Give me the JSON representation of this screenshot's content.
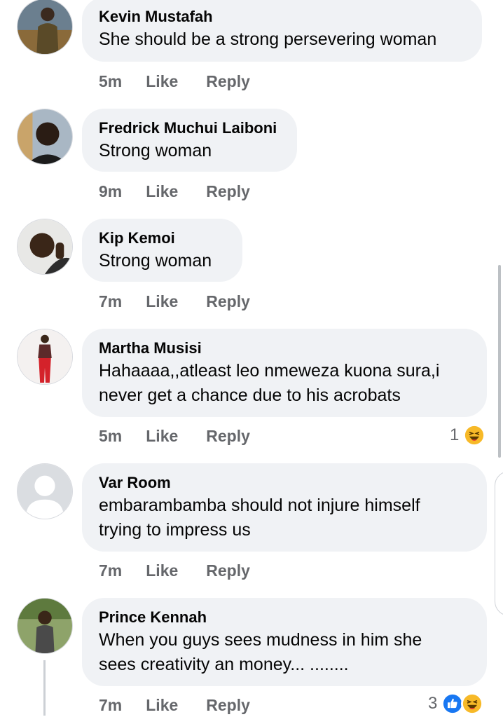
{
  "comments": [
    {
      "author": "Kevin Mustafah",
      "text": [
        "She should be a strong persevering woman"
      ],
      "time": "5m",
      "like": "Like",
      "reply": "Reply",
      "avatar_icon": "person-photo-icon"
    },
    {
      "author": "Fredrick Muchui Laiboni",
      "text": [
        "Strong woman"
      ],
      "time": "9m",
      "like": "Like",
      "reply": "Reply",
      "avatar_icon": "person-photo-icon"
    },
    {
      "author": "Kip Kemoi",
      "text": [
        "Strong woman"
      ],
      "time": "7m",
      "like": "Like",
      "reply": "Reply",
      "avatar_icon": "person-photo-icon"
    },
    {
      "author": "Martha Musisi",
      "text": [
        "Hahaaaa,,atleast leo nmeweza kuona sura,i",
        "never get a chance due to his acrobats"
      ],
      "time": "5m",
      "like": "Like",
      "reply": "Reply",
      "reaction_count": "1",
      "reaction_icons": [
        "haha-icon"
      ],
      "avatar_icon": "person-photo-icon"
    },
    {
      "author": "Var Room",
      "text": [
        "embarambamba should not injure himself",
        "trying to impress us"
      ],
      "time": "7m",
      "like": "Like",
      "reply": "Reply",
      "avatar_icon": "default-user-icon"
    },
    {
      "author": "Prince Kennah",
      "text": [
        "When you guys sees mudness in him she",
        "sees creativity an money... ........"
      ],
      "time": "7m",
      "like": "Like",
      "reply": "Reply",
      "reaction_count": "3",
      "reaction_icons": [
        "like-icon",
        "haha-icon"
      ],
      "avatar_icon": "person-photo-icon"
    }
  ],
  "colors": {
    "bubble": "#f0f2f5",
    "meta_text": "#65676b",
    "like_blue": "#1877f2",
    "haha_yellow": "#f7b928"
  }
}
